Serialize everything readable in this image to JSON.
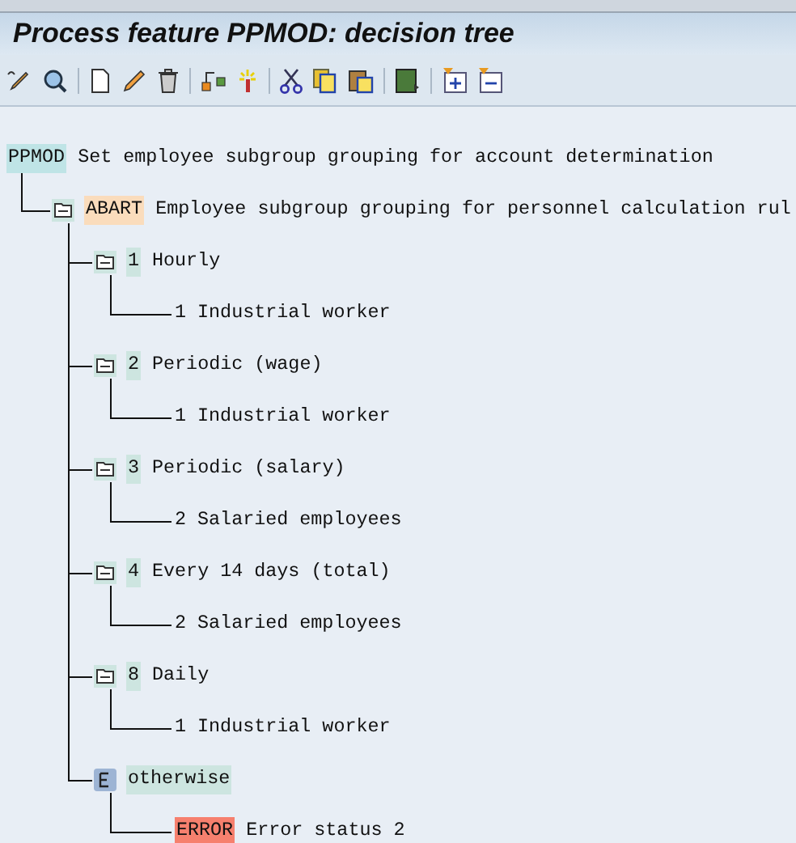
{
  "window": {
    "title": "Process feature PPMOD: decision tree"
  },
  "tree": [
    {
      "kind": "root",
      "code": "PPMOD",
      "text": "Set employee subgroup grouping for account determination",
      "children": [
        {
          "kind": "feature",
          "code": "ABART",
          "text": "Employee subgroup grouping for personnel calculation rul",
          "children": [
            {
              "kind": "value",
              "code": "1",
              "text": "Hourly",
              "children": [
                {
                  "kind": "leaf",
                  "text": "1 Industrial worker"
                }
              ]
            },
            {
              "kind": "value",
              "code": "2",
              "text": "Periodic (wage)",
              "children": [
                {
                  "kind": "leaf",
                  "text": "1 Industrial worker"
                }
              ]
            },
            {
              "kind": "value",
              "code": "3",
              "text": "Periodic (salary)",
              "children": [
                {
                  "kind": "leaf",
                  "text": "2 Salaried employees"
                }
              ]
            },
            {
              "kind": "value",
              "code": "4",
              "text": "Every 14 days (total)",
              "children": [
                {
                  "kind": "leaf",
                  "text": "2 Salaried employees"
                }
              ]
            },
            {
              "kind": "value",
              "code": "8",
              "text": "Daily",
              "children": [
                {
                  "kind": "leaf",
                  "text": "1 Industrial worker"
                }
              ]
            },
            {
              "kind": "otherwise",
              "text": "otherwise",
              "children": [
                {
                  "kind": "error",
                  "code": "ERROR",
                  "text": "Error status 2"
                }
              ]
            }
          ]
        }
      ]
    }
  ]
}
